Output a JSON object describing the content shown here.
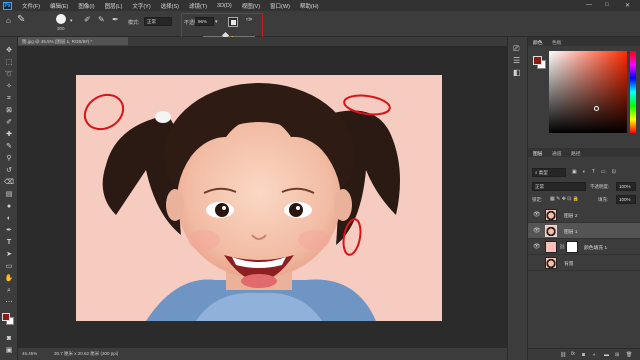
{
  "app": {
    "logo": "Ps"
  },
  "menu": [
    "文件(F)",
    "编辑(E)",
    "图像(I)",
    "图层(L)",
    "文字(Y)",
    "选择(S)",
    "滤镜(T)",
    "3D(D)",
    "视图(V)",
    "窗口(W)",
    "帮助(H)"
  ],
  "window_controls": {
    "minimize": "—",
    "maximize": "□",
    "close": "✕"
  },
  "options_bar": {
    "brush_size": "300",
    "mode_label": "模式:",
    "mode_value": "正常",
    "opacity_label": "不透明度:",
    "opacity_value": "96%",
    "icons": [
      "brush-preset-icon",
      "pressure-opacity-icon",
      "pressure-size-icon"
    ]
  },
  "document": {
    "tab_title": "图.jpg @ 45.5% (图层 1, RGB/8#) *",
    "zoom": "45.45%",
    "status": "30.7 厘米 x 20.62 厘米 (300 ppi)"
  },
  "dock_icons": [
    "history-icon",
    "properties-icon",
    "adjustments-icon"
  ],
  "color_panel": {
    "tabs": [
      "颜色",
      "色板"
    ],
    "fg_color": "#8a1a14",
    "bg_color": "#ffffff",
    "hue_color": "#ff2a00"
  },
  "layers_panel": {
    "tabs": [
      "图层",
      "通道",
      "路径"
    ],
    "filter_label": "类型",
    "blend_mode": "正常",
    "opacity_label": "不透明度:",
    "opacity_value": "100%",
    "lock_label": "锁定:",
    "fill_label": "填充:",
    "fill_value": "100%",
    "layers": [
      {
        "name": "图层 2",
        "visible": true,
        "selected": false,
        "kind": "photo"
      },
      {
        "name": "图层 1",
        "visible": true,
        "selected": true,
        "kind": "photo"
      },
      {
        "name": "颜色填充 1",
        "visible": true,
        "selected": false,
        "kind": "fill"
      },
      {
        "name": "背景",
        "visible": false,
        "selected": false,
        "kind": "photo"
      }
    ]
  },
  "accent_colors": {
    "annotation_red": "#d8141a",
    "ps_blue": "#31a8ff"
  }
}
